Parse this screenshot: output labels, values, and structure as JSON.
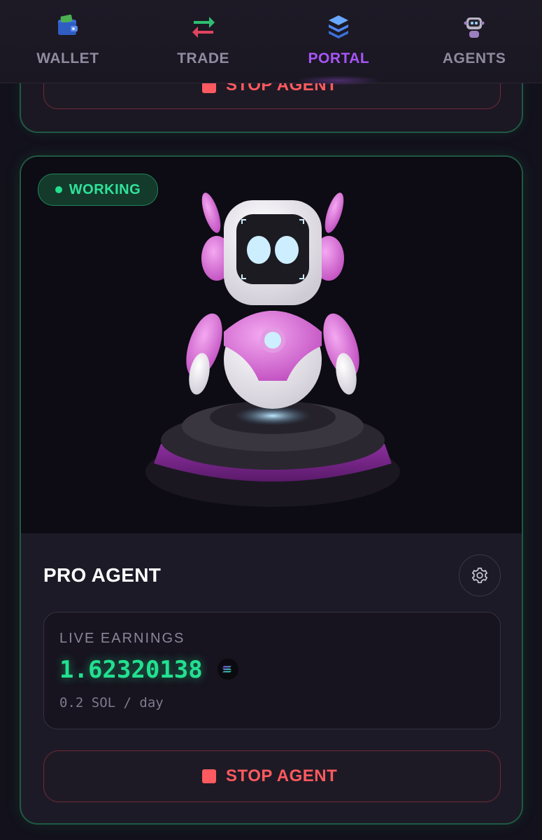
{
  "nav": {
    "items": [
      {
        "label": "WALLET",
        "icon": "wallet-icon"
      },
      {
        "label": "TRADE",
        "icon": "trade-arrows-icon"
      },
      {
        "label": "PORTAL",
        "icon": "portal-layers-icon",
        "active": true
      },
      {
        "label": "AGENTS",
        "icon": "robot-head-icon"
      }
    ],
    "active_color": "#a855f7",
    "inactive_color": "#8f8aa0"
  },
  "previous_card": {
    "stop_label": "STOP AGENT"
  },
  "agent_card": {
    "status": "WORKING",
    "status_color": "#2fe39a",
    "image": "robot-illustration",
    "title": "PRO AGENT",
    "settings_icon": "gear-icon",
    "earnings": {
      "label": "LIVE EARNINGS",
      "value": "1.62320138",
      "currency_icon": "solana-icon",
      "rate": "0.2 SOL / day",
      "value_color": "#22e08f"
    },
    "stop_label": "STOP AGENT",
    "stop_color": "#ff5a5f"
  }
}
